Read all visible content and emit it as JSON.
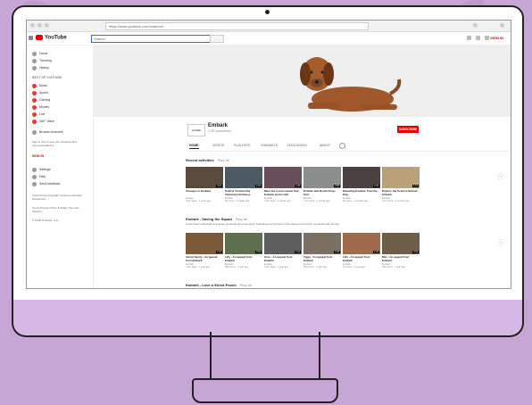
{
  "browser": {
    "url": "https://www.youtube.com/channel/..."
  },
  "youtube": {
    "logo_text": "YouTube",
    "search_placeholder": "Search",
    "signin_label": "SIGN IN"
  },
  "sidebar": {
    "items": [
      {
        "label": "Home",
        "icon": "home-icon"
      },
      {
        "label": "Trending",
        "icon": "trending-icon"
      },
      {
        "label": "History",
        "icon": "history-icon"
      }
    ],
    "best_header": "BEST OF YOUTUBE",
    "best_items": [
      {
        "label": "Music",
        "icon": "music-icon"
      },
      {
        "label": "Sports",
        "icon": "sports-icon"
      },
      {
        "label": "Gaming",
        "icon": "gaming-icon"
      },
      {
        "label": "Movies",
        "icon": "movies-icon"
      },
      {
        "label": "Live",
        "icon": "live-icon"
      },
      {
        "label": "360° Video",
        "icon": "vr-icon"
      }
    ],
    "browse_channels": "Browse channels",
    "signin_prompt": "Sign in now to see your channels and recommendations!",
    "signin_link": "SIGN IN",
    "more_items": [
      {
        "label": "Settings",
        "icon": "gear-icon"
      },
      {
        "label": "Help",
        "icon": "help-icon"
      },
      {
        "label": "Send feedback",
        "icon": "feedback-icon"
      }
    ],
    "footer_text_1": "About  Press  Copyright  Creators  Advertise  Developers",
    "footer_text_2": "Terms  Privacy  Policy & Safety  Test new features",
    "footer_copy": "© 2018 YouTube, LLC"
  },
  "channel": {
    "avatar_text": "embark",
    "name": "Embark",
    "subscribers": "1.2K subscribers",
    "subscribe_label": "SUBSCRIBE",
    "tabs": [
      "HOME",
      "VIDEOS",
      "PLAYLISTS",
      "CHANNELS",
      "DISCUSSION",
      "ABOUT"
    ]
  },
  "sections": {
    "featured": {
      "title": "Recent activities",
      "play_all": "Play all",
      "videos": [
        {
          "title": "Changes to Embark",
          "meta1": "Embark",
          "meta2": "2.1K views · 1 week ago",
          "dur": "3:21",
          "color": "#5a4a3e"
        },
        {
          "title": "Solid & Trustworthy Veterinary Embassy",
          "meta1": "Embark",
          "meta2": "4K views · 2 weeks ago",
          "dur": "2:10",
          "color": "#4d5a63"
        },
        {
          "title": "Meet the rescue teams that Embark works with",
          "meta1": "Embark",
          "meta2": "7.4K views · 1 month ago",
          "dur": "1:45",
          "color": "#6b4e5c"
        },
        {
          "title": "Embark and Bryant Dogs Pets",
          "meta1": "Embark",
          "meta2": "1.1K views · 1 month ago",
          "dur": "0:58",
          "color": "#8a8f8e"
        },
        {
          "title": "Elevating Embark: Favorite Dog",
          "meta1": "Embark",
          "meta2": "3K views · 2 months ago",
          "dur": "2:40",
          "color": "#4a4240"
        },
        {
          "title": "Explore the Science Behind Embark",
          "meta1": "Embark",
          "meta2": "2.7K views · 2 months ago",
          "dur": "1:12",
          "color": "#b9a27a"
        }
      ]
    },
    "rescue": {
      "title": "Embark - Saving the Squad",
      "play_all": "Play all",
      "desc": "At the heart of Embark is a group of people who love dogs. Following our partners in the rescue community, we share their stories.",
      "videos": [
        {
          "title": "Adopt Sandy - An appeal from Embark",
          "meta1": "Embark",
          "meta2": "1.5K views · 1 year ago",
          "dur": "1:01",
          "color": "#7a5a3a"
        },
        {
          "title": "Lilly - An appeal from Embark",
          "meta1": "Embark",
          "meta2": "950 views · 1 year ago",
          "dur": "0:55",
          "color": "#5d6f4c"
        },
        {
          "title": "Oreo - An appeal from Embark",
          "meta1": "Embark",
          "meta2": "1.2K views · 1 year ago",
          "dur": "1:10",
          "color": "#5e5e5e"
        },
        {
          "title": "Ziggy - An appeal from Embark",
          "meta1": "Embark",
          "meta2": "870 views · 1 year ago",
          "dur": "0:48",
          "color": "#7a6f62"
        },
        {
          "title": "Lilly - An appeal from Embark",
          "meta1": "Embark",
          "meta2": "1K views · 1 year ago",
          "dur": "1:03",
          "color": "#a06a4c"
        },
        {
          "title": "Max - An appeal from Embark",
          "meta1": "Embark",
          "meta2": "640 views · 1 year ago",
          "dur": "0:59",
          "color": "#6e5d48"
        }
      ]
    },
    "next": {
      "title": "Embark - Love a Street Pooch",
      "play_all": "Play all"
    }
  }
}
